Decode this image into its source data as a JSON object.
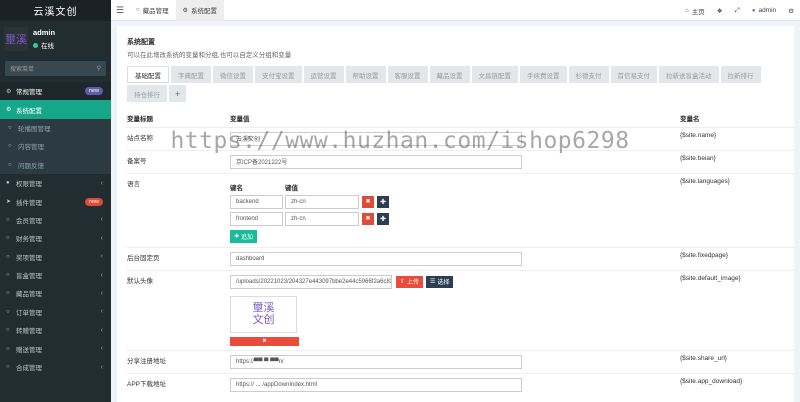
{
  "sidebar": {
    "logo": "云溪文创",
    "avatar_text": "壐溪",
    "user": {
      "name": "admin",
      "status": "在线"
    },
    "search_placeholder": "搜索菜单",
    "items": [
      {
        "label": "常规管理",
        "icon": "cogs-icon",
        "badge": "new",
        "badge_color": "#605ca8",
        "type": "header"
      },
      {
        "label": "系统配置",
        "icon": "gear-icon",
        "type": "active"
      },
      {
        "label": "轮播图管理",
        "icon": "circle-icon",
        "type": "sub"
      },
      {
        "label": "内容管理",
        "icon": "circle-icon",
        "type": "sub"
      },
      {
        "label": "问题反馈",
        "icon": "circle-icon",
        "type": "sub"
      },
      {
        "label": "权限管理",
        "icon": "group-icon",
        "arrow": "‹"
      },
      {
        "label": "插件管理",
        "icon": "rocket-icon",
        "badge": "new",
        "badge_color": "#dd4b39"
      },
      {
        "label": "会员管理",
        "icon": "circle-icon",
        "arrow": "‹"
      },
      {
        "label": "财务管理",
        "icon": "circle-icon",
        "arrow": "‹"
      },
      {
        "label": "奖项管理",
        "icon": "circle-icon",
        "arrow": "‹"
      },
      {
        "label": "盲盒管理",
        "icon": "circle-icon",
        "arrow": "‹"
      },
      {
        "label": "藏品管理",
        "icon": "circle-icon",
        "arrow": "‹"
      },
      {
        "label": "订单管理",
        "icon": "circle-icon",
        "arrow": "‹"
      },
      {
        "label": "转赠管理",
        "icon": "circle-icon",
        "arrow": "‹"
      },
      {
        "label": "赠送管理",
        "icon": "circle-icon",
        "arrow": "‹"
      },
      {
        "label": "合成管理",
        "icon": "circle-icon",
        "arrow": "‹"
      }
    ]
  },
  "topbar": {
    "tabs": [
      {
        "label": "藏品管理",
        "icon": "circle-icon"
      },
      {
        "label": "系统配置",
        "icon": "gear-icon"
      }
    ],
    "home": "主页",
    "admin": "admin"
  },
  "panel": {
    "title": "系统配置",
    "subtitle": "可以在此增改系统的变量和分组,也可以自定义分组和变量",
    "tabs": [
      "基础配置",
      "字典配置",
      "微信设置",
      "支付宝设置",
      "运营设置",
      "帮助设置",
      "客服设置",
      "藏品设置",
      "文昌链配置",
      "手续费设置",
      "杉德支付",
      "首信易支付",
      "拉新送盲盒活动",
      "拉新排行",
      "持仓排行",
      "+"
    ],
    "columns": {
      "title": "变量标题",
      "value": "变量值",
      "name": "变量名"
    },
    "rows": {
      "site_name": {
        "title": "站点名称",
        "value": "云溪文创",
        "name": "{$site.name}"
      },
      "beian": {
        "title": "备案号",
        "value": "京ICP备2021222号",
        "name": "{$site.beian}"
      },
      "languages": {
        "title": "语言",
        "key_header": "键名",
        "value_header": "键值",
        "items": [
          {
            "key": "backend",
            "value": "zh-cn"
          },
          {
            "key": "frontend",
            "value": "zh-cn"
          }
        ],
        "add_label": "追加",
        "name": "{$site.languages}"
      },
      "fixedpage": {
        "title": "后台固定页",
        "value": "dashboard",
        "name": "{$site.fixedpage}"
      },
      "avatar": {
        "title": "默认头像",
        "value": "/uploads/20221023/204327e443097bbe2e44c5966f2a6c82",
        "upload_label": "上传",
        "select_label": "选择",
        "thumb_text": "壐溪文创",
        "name": "{$site.default_image}"
      },
      "share_url": {
        "title": "分享注册地址",
        "value": "https://▀▀ ▀ ▀▀n/",
        "name": "{$site.share_url}"
      },
      "app_download": {
        "title": "APP下载地址",
        "value": "https:// ... /appDownIndex.html",
        "name": "{$site.app_download}"
      }
    }
  },
  "watermark": "https://www.huzhan.com/ishop6298"
}
